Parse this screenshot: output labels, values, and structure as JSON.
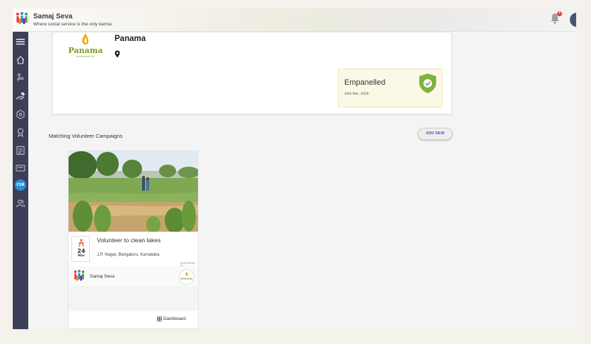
{
  "header": {
    "brand_name": "Samaj Seva",
    "brand_tagline": "Where social service is the only karma",
    "notification_count": "4",
    "icons": [
      "samaj-seva-logo-icon",
      "bell-icon",
      "avatar"
    ]
  },
  "sidebar": {
    "items": [
      {
        "name": "menu",
        "icon": "hamburger-icon"
      },
      {
        "name": "home",
        "icon": "home-icon"
      },
      {
        "name": "volunteer",
        "icon": "volunteer-icon"
      },
      {
        "name": "donate",
        "icon": "donate-hand-icon"
      },
      {
        "name": "badge",
        "icon": "badge-icon"
      },
      {
        "name": "award",
        "icon": "award-icon"
      },
      {
        "name": "directory",
        "icon": "directory-icon"
      },
      {
        "name": "ngo",
        "icon": "ngo-icon",
        "label": "NGO"
      },
      {
        "name": "csr",
        "icon": "csr-icon",
        "label": "CSR",
        "active": true
      },
      {
        "name": "users",
        "icon": "users-icon"
      }
    ]
  },
  "company": {
    "name": "Panama",
    "logo_text": "Panama",
    "status_label": "Empanelled",
    "status_date": "24th Mar, 2016",
    "icons": [
      "location-pin-icon",
      "shield-check-icon"
    ]
  },
  "campaigns": {
    "section_title": "Matching Volunteer Campaigns",
    "add_new_label": "ADD NEW",
    "items": [
      {
        "title": "Volunteer to clean lakes",
        "location": "J.P. Nagar, Bengaluru, Karnataka",
        "day": "24",
        "month": "Mar",
        "supported_by": "SUPPORTED BY",
        "organizer": "Samaj Seva",
        "sponsor": "Panama",
        "dashboard_label": "Dashboard"
      }
    ]
  },
  "colors": {
    "sidebar": "#3b3f58",
    "active": "#2b8fd6",
    "empanelled_bg": "#fbf8e6",
    "shield": "#7cb342",
    "add_new_text": "#5b56b8"
  }
}
